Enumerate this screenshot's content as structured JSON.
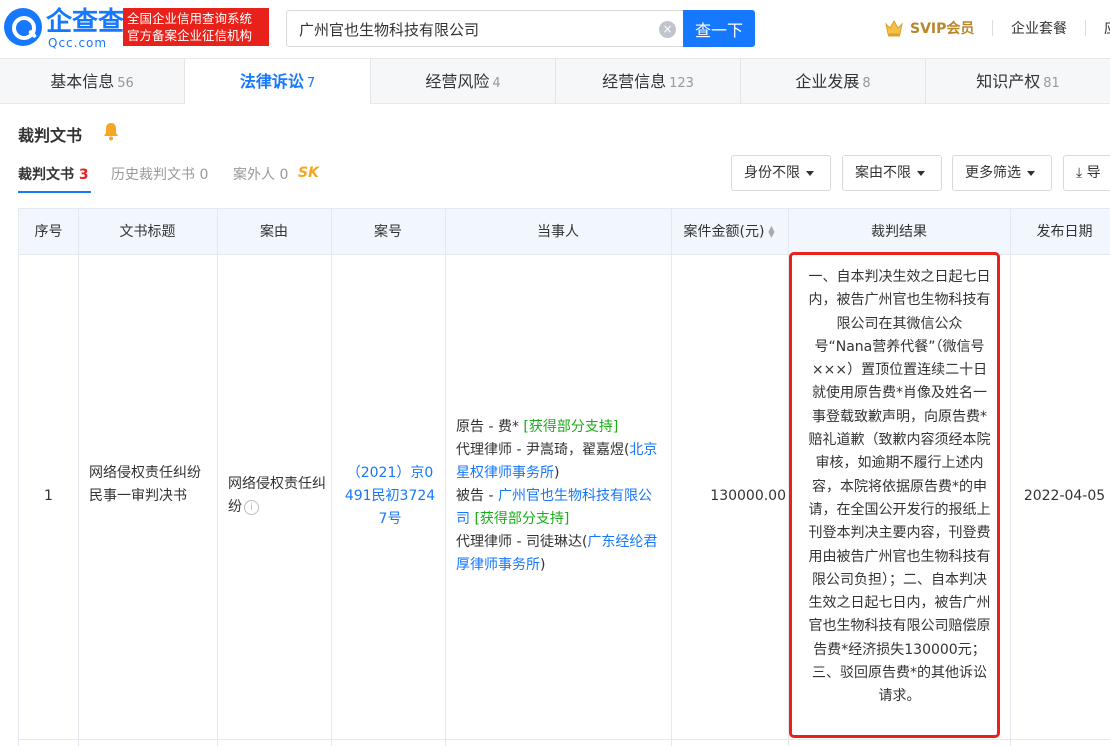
{
  "header": {
    "logo_name": "企查查",
    "logo_sub": "Qcc.com",
    "slogan_line1": "全国企业信用查询系统",
    "slogan_line2": "官方备案企业征信机构",
    "search_value": "广州官也生物科技有限公司",
    "search_button": "查一下",
    "svip_label": "SVIP会员",
    "enterprise_label": "企业套餐",
    "more_label": "应"
  },
  "tabs": [
    {
      "label": "基本信息",
      "count": "56"
    },
    {
      "label": "法律诉讼",
      "count": "7"
    },
    {
      "label": "经营风险",
      "count": "4"
    },
    {
      "label": "经营信息",
      "count": "123"
    },
    {
      "label": "企业发展",
      "count": "8"
    },
    {
      "label": "知识产权",
      "count": "81"
    }
  ],
  "section": {
    "title": "裁判文书",
    "subtabs": [
      {
        "label": "裁判文书",
        "count": "3"
      },
      {
        "label": "历史裁判文书",
        "count": "0"
      },
      {
        "label": "案外人",
        "count": "0"
      }
    ],
    "sk_badge": "SK",
    "filters": [
      "身份不限",
      "案由不限",
      "更多筛选",
      "导"
    ]
  },
  "table": {
    "headers": [
      "序号",
      "文书标题",
      "案由",
      "案号",
      "当事人",
      "案件金额(元)",
      "裁判结果",
      "发布日期"
    ],
    "row": {
      "index": "1",
      "title": "网络侵权责任纠纷民事一审判决书",
      "cause": "网络侵权责任纠纷",
      "case_no": "（2021）京0491民初37247号",
      "party_plaintiff_prefix": "原告 - 费*",
      "party_plaintiff_tag": "[获得部分支持]",
      "party_agent1_prefix": "代理律师 - 尹嵩琦，翟嘉煜(",
      "party_agent1_firm": "北京星权律师事务所",
      "party_agent1_suffix": ")",
      "party_defendant_prefix": "被告 - ",
      "party_defendant_name": "广州官也生物科技有限公司",
      "party_defendant_tag": "[获得部分支持]",
      "party_agent2_prefix": "代理律师 - 司徒琳达(",
      "party_agent2_firm": "广东经纶君厚律师事务所",
      "party_agent2_suffix": ")",
      "amount": "130000.00",
      "result": "一、自本判决生效之日起七日内，被告广州官也生物科技有限公司在其微信公众号“Nana营养代餐”（微信号×××）置顶位置连续二十日就使用原告费*肖像及姓名一事登载致歉声明，向原告费*赔礼道歉（致歉内容须经本院审核，如逾期不履行上述内容，本院将依据原告费*的申请，在全国公开发行的报纸上刊登本判决主要内容，刊登费用由被告广州官也生物科技有限公司负担）；二、自本判决生效之日起七日内，被告广州官也生物科技有限公司赔偿原告费*经济损失130000元；三、驳回原告费*的其他诉讼请求。",
      "date": "2022-04-05"
    }
  },
  "colors": {
    "brand": "#1677ff",
    "highlight": "#e8211a",
    "tag_green": "#1aad19",
    "svip_gold": "#b8862b"
  }
}
